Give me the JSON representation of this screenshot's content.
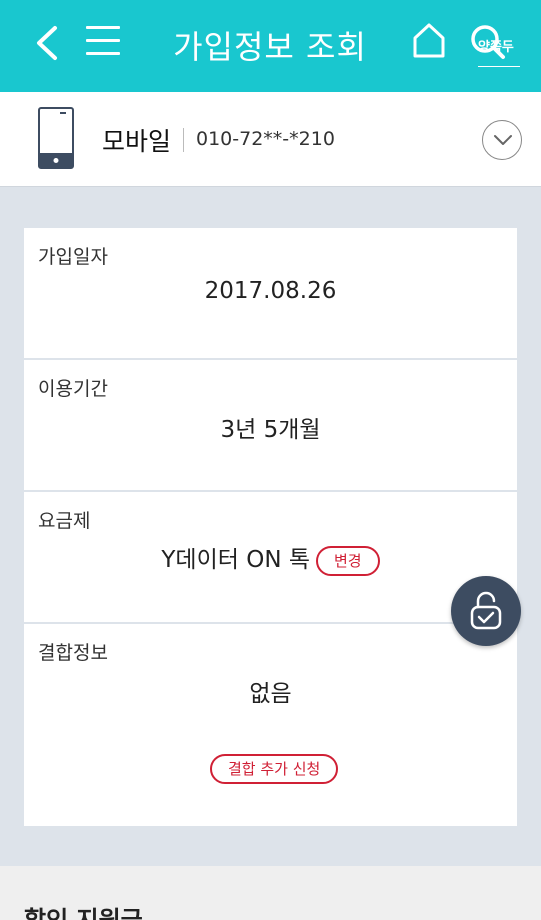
{
  "header": {
    "title": "가입정보 조회",
    "search_label": "양쪽두",
    "accent_color": "#19c7cf",
    "icons": [
      "back-icon",
      "menu-icon",
      "home-icon",
      "search-icon"
    ]
  },
  "line": {
    "type": "모바일",
    "number": "010-72**-*210",
    "icon": "phone-icon"
  },
  "details": {
    "join_date_label": "가입일자",
    "join_date": "2017.08.26",
    "period_label": "이용기간",
    "period": "3년 5개월",
    "plan_label": "요금제",
    "plan": "Y데이터 ON 톡",
    "plan_change_button": "변경",
    "combo_label": "결합정보",
    "combo": "없음",
    "combo_add_button": "결합 추가 신청"
  },
  "bottom": {
    "title": "할인 지원금"
  },
  "floating": {
    "icon": "unlock-check-icon",
    "color": "#3d4c61"
  }
}
